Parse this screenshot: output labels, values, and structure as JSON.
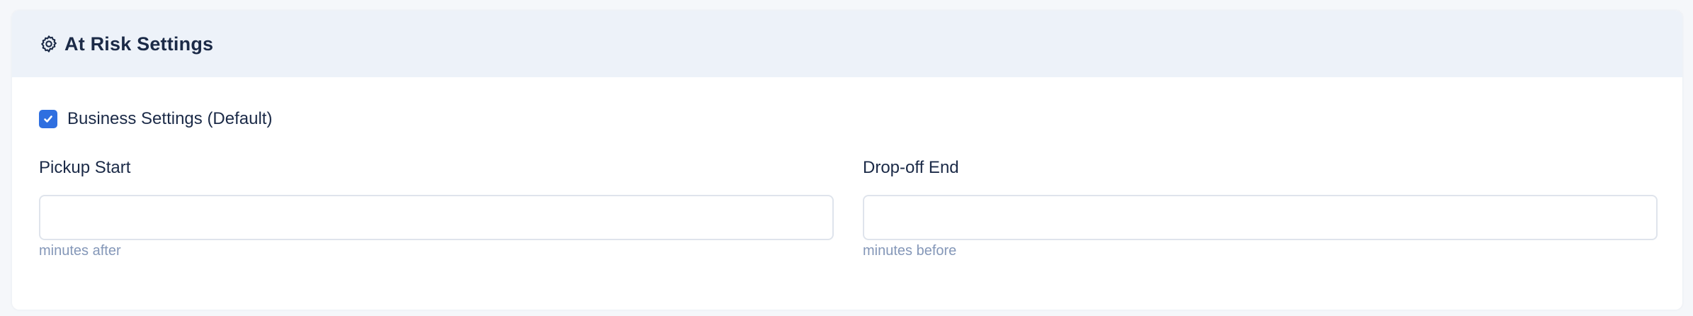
{
  "header": {
    "title": "At Risk Settings",
    "icon": "gear-icon"
  },
  "business_settings": {
    "label": "Business Settings (Default)",
    "checked": true,
    "accent_color": "#2f6fe0"
  },
  "fields": {
    "pickup_start": {
      "label": "Pickup Start",
      "value": "",
      "hint": "minutes after"
    },
    "dropoff_end": {
      "label": "Drop-off End",
      "value": "",
      "hint": "minutes before"
    }
  }
}
